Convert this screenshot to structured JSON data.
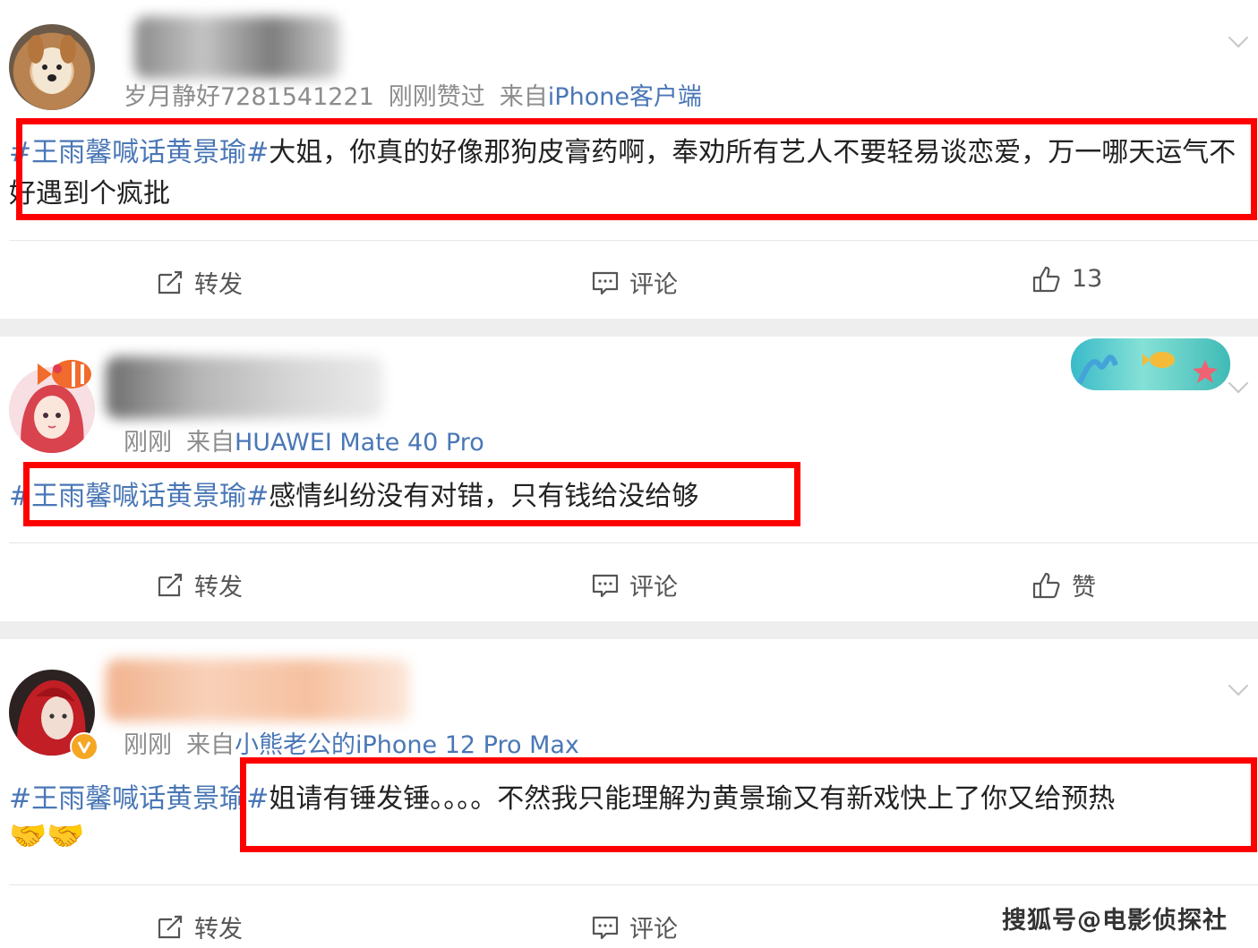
{
  "posts": [
    {
      "username_visible": "岁月静好7281541221",
      "time": "刚刚赞过",
      "source_prefix": "来自",
      "source": "iPhone客户端",
      "topic": "#王雨馨喊话黄景瑜#",
      "content": "大姐，你真的好像那狗皮膏药啊，奉劝所有艺人不要轻易谈恋爱，万一哪天运气不好遇到个疯批",
      "emoji": "",
      "actions": {
        "repost": "转发",
        "comment": "评论",
        "like": "13"
      }
    },
    {
      "username_visible": "",
      "time": "刚刚",
      "source_prefix": "来自",
      "source": "HUAWEI Mate 40 Pro",
      "topic": "#王雨馨喊话黄景瑜#",
      "content": "感情纠纷没有对错，只有钱给没给够",
      "emoji": "",
      "actions": {
        "repost": "转发",
        "comment": "评论",
        "like": "赞"
      }
    },
    {
      "username_visible": "",
      "time": "刚刚",
      "source_prefix": "来自",
      "source": "小熊老公的iPhone 12 Pro Max",
      "topic": "#王雨馨喊话黄景瑜#",
      "content": "姐请有锤发锤。。。。不然我只能理解为黄景瑜又有新戏快上了你又给预热",
      "emoji": "🤝🤝",
      "actions": {
        "repost": "转发",
        "comment": "评论",
        "like": ""
      }
    }
  ],
  "watermark": "搜狐号@电影侦探社",
  "colors": {
    "link": "#4a77b6",
    "highlight_box": "#ff0000",
    "meta": "#8c8c8c",
    "separator": "#eeeeee"
  },
  "icons": {
    "repost": "repost-icon",
    "comment": "comment-icon",
    "like": "thumbs-up-icon",
    "more": "chevron-down-icon"
  }
}
